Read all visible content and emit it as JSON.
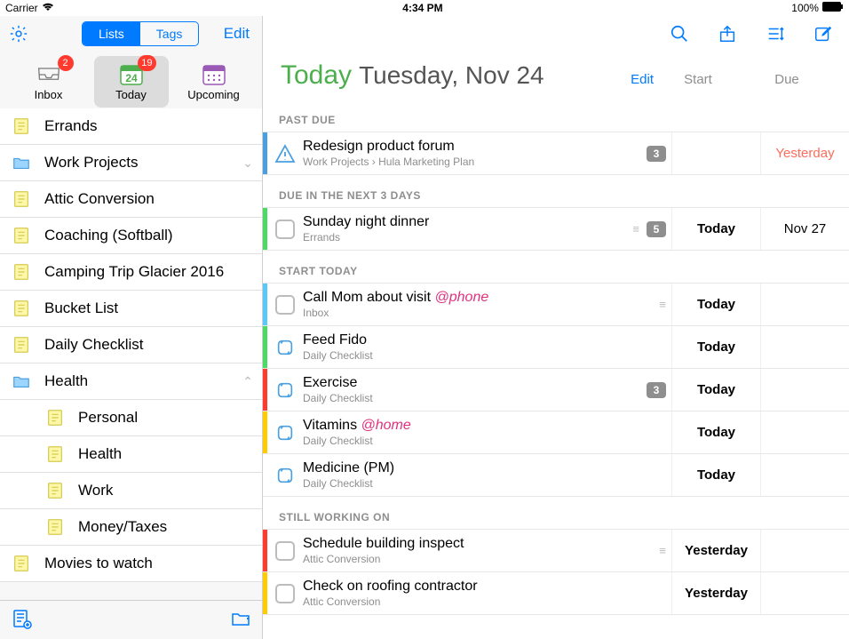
{
  "status": {
    "carrier": "Carrier",
    "time": "4:34 PM",
    "battery": "100%"
  },
  "leftHeader": {
    "seg_lists": "Lists",
    "seg_tags": "Tags",
    "edit": "Edit"
  },
  "tabs": {
    "inbox": {
      "label": "Inbox",
      "badge": "2"
    },
    "today": {
      "label": "Today",
      "badge": "19",
      "daynum": "24"
    },
    "upcoming": {
      "label": "Upcoming"
    }
  },
  "tree": [
    {
      "type": "note",
      "label": "Errands"
    },
    {
      "type": "folder",
      "label": "Work Projects",
      "chev": "down"
    },
    {
      "type": "note",
      "label": "Attic Conversion"
    },
    {
      "type": "note",
      "label": "Coaching (Softball)"
    },
    {
      "type": "note",
      "label": "Camping Trip Glacier 2016"
    },
    {
      "type": "note",
      "label": "Bucket List"
    },
    {
      "type": "note",
      "label": "Daily Checklist"
    },
    {
      "type": "folder",
      "label": "Health",
      "chev": "up"
    },
    {
      "type": "note",
      "label": "Personal",
      "indent": true
    },
    {
      "type": "note",
      "label": "Health",
      "indent": true
    },
    {
      "type": "note",
      "label": "Work",
      "indent": true
    },
    {
      "type": "note",
      "label": "Money/Taxes",
      "indent": true
    },
    {
      "type": "note",
      "label": "Movies to watch"
    }
  ],
  "title": {
    "today": "Today",
    "date": "Tuesday, Nov 24"
  },
  "cols": {
    "edit": "Edit",
    "start": "Start",
    "due": "Due"
  },
  "sections": {
    "pastdue": "PAST DUE",
    "next3": "DUE IN THE NEXT 3 DAYS",
    "starttoday": "START TODAY",
    "working": "STILL WORKING ON"
  },
  "tasks": {
    "t1": {
      "title": "Redesign product forum",
      "sub": "Work Projects › Hula Marketing Plan",
      "count": "3",
      "due": "Yesterday"
    },
    "t2": {
      "title": "Sunday night dinner",
      "sub": "Errands",
      "count": "5",
      "start": "Today",
      "due": "Nov 27"
    },
    "t3": {
      "title": "Call Mom about visit ",
      "tag": "@phone",
      "sub": "Inbox",
      "start": "Today"
    },
    "t4": {
      "title": "Feed Fido",
      "sub": "Daily Checklist",
      "start": "Today"
    },
    "t5": {
      "title": "Exercise",
      "sub": "Daily Checklist",
      "count": "3",
      "start": "Today"
    },
    "t6": {
      "title": "Vitamins ",
      "tag": "@home",
      "sub": "Daily Checklist",
      "start": "Today"
    },
    "t7": {
      "title": "Medicine (PM)",
      "sub": "Daily Checklist",
      "start": "Today"
    },
    "t8": {
      "title": "Schedule building inspect",
      "sub": "Attic Conversion",
      "start": "Yesterday"
    },
    "t9": {
      "title": "Check on roofing contractor",
      "sub": "Attic Conversion",
      "start": "Yesterday"
    }
  }
}
